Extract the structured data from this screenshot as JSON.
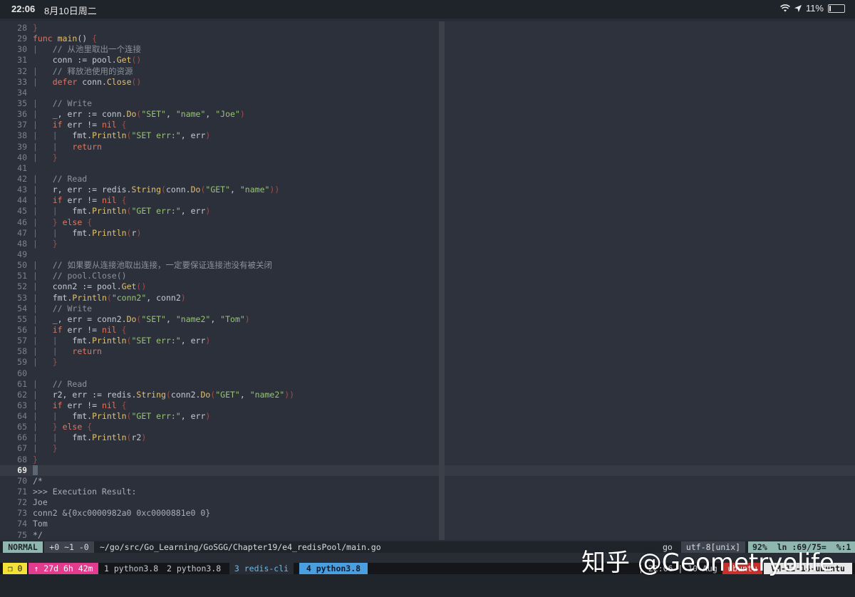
{
  "ios_status": {
    "time": "22:06",
    "date": "8月10日周二",
    "battery": "11%",
    "battery_level": 0.11
  },
  "editor": {
    "lines": [
      {
        "n": "28",
        "t": [
          [
            "}",
            "pn"
          ]
        ]
      },
      {
        "n": "29",
        "t": [
          [
            "func ",
            "kw"
          ],
          [
            "main",
            "fn"
          ],
          [
            "() ",
            "text"
          ],
          [
            "{",
            "pn"
          ]
        ]
      },
      {
        "n": "30",
        "t": [
          [
            "|   ",
            "guide"
          ],
          [
            "// 从池里取出一个连接",
            "cm"
          ]
        ]
      },
      {
        "n": "31",
        "t": [
          [
            "    conn := pool.",
            "text"
          ],
          [
            "Get",
            "fn"
          ],
          [
            "()",
            "pn"
          ]
        ]
      },
      {
        "n": "32",
        "t": [
          [
            "|   ",
            "guide"
          ],
          [
            "// 释放池使用的资源",
            "cm"
          ]
        ]
      },
      {
        "n": "33",
        "t": [
          [
            "|   ",
            "guide"
          ],
          [
            "defer ",
            "kw"
          ],
          [
            "conn.",
            "text"
          ],
          [
            "Close",
            "fn"
          ],
          [
            "()",
            "pn"
          ]
        ]
      },
      {
        "n": "34",
        "t": []
      },
      {
        "n": "35",
        "t": [
          [
            "|   ",
            "guide"
          ],
          [
            "// Write",
            "cm"
          ]
        ]
      },
      {
        "n": "36",
        "t": [
          [
            "|   ",
            "guide"
          ],
          [
            "_, err := conn.",
            "text"
          ],
          [
            "Do",
            "fn"
          ],
          [
            "(",
            "pn"
          ],
          [
            "\"SET\"",
            "str"
          ],
          [
            ", ",
            "text"
          ],
          [
            "\"name\"",
            "str"
          ],
          [
            ", ",
            "text"
          ],
          [
            "\"Joe\"",
            "str"
          ],
          [
            ")",
            "pn"
          ]
        ]
      },
      {
        "n": "37",
        "t": [
          [
            "|   ",
            "guide"
          ],
          [
            "if ",
            "kw"
          ],
          [
            "err != ",
            "text"
          ],
          [
            "nil ",
            "kw"
          ],
          [
            "{",
            "pn"
          ]
        ]
      },
      {
        "n": "38",
        "t": [
          [
            "|   |   ",
            "guide"
          ],
          [
            "fmt.",
            "text"
          ],
          [
            "Println",
            "fn"
          ],
          [
            "(",
            "pn"
          ],
          [
            "\"SET err:\"",
            "str"
          ],
          [
            ", err",
            "text"
          ],
          [
            ")",
            "pn"
          ]
        ]
      },
      {
        "n": "39",
        "t": [
          [
            "|   |   ",
            "guide"
          ],
          [
            "return",
            "kw"
          ]
        ]
      },
      {
        "n": "40",
        "t": [
          [
            "|   ",
            "guide"
          ],
          [
            "}",
            "pn"
          ]
        ]
      },
      {
        "n": "41",
        "t": []
      },
      {
        "n": "42",
        "t": [
          [
            "|   ",
            "guide"
          ],
          [
            "// Read",
            "cm"
          ]
        ]
      },
      {
        "n": "43",
        "t": [
          [
            "|   ",
            "guide"
          ],
          [
            "r, err := redis.",
            "text"
          ],
          [
            "String",
            "fn"
          ],
          [
            "(",
            "pn"
          ],
          [
            "conn.",
            "text"
          ],
          [
            "Do",
            "fn"
          ],
          [
            "(",
            "pn"
          ],
          [
            "\"GET\"",
            "str"
          ],
          [
            ", ",
            "text"
          ],
          [
            "\"name\"",
            "str"
          ],
          [
            "))",
            "pn"
          ]
        ]
      },
      {
        "n": "44",
        "t": [
          [
            "|   ",
            "guide"
          ],
          [
            "if ",
            "kw"
          ],
          [
            "err != ",
            "text"
          ],
          [
            "nil ",
            "kw"
          ],
          [
            "{",
            "pn"
          ]
        ]
      },
      {
        "n": "45",
        "t": [
          [
            "|   |   ",
            "guide"
          ],
          [
            "fmt.",
            "text"
          ],
          [
            "Println",
            "fn"
          ],
          [
            "(",
            "pn"
          ],
          [
            "\"GET err:\"",
            "str"
          ],
          [
            ", err",
            "text"
          ],
          [
            ")",
            "pn"
          ]
        ]
      },
      {
        "n": "46",
        "t": [
          [
            "|   ",
            "guide"
          ],
          [
            "} ",
            "pn"
          ],
          [
            "else ",
            "kw"
          ],
          [
            "{",
            "pn"
          ]
        ]
      },
      {
        "n": "47",
        "t": [
          [
            "|   |   ",
            "guide"
          ],
          [
            "fmt.",
            "text"
          ],
          [
            "Println",
            "fn"
          ],
          [
            "(",
            "pn"
          ],
          [
            "r",
            "text"
          ],
          [
            ")",
            "pn"
          ]
        ]
      },
      {
        "n": "48",
        "t": [
          [
            "|   ",
            "guide"
          ],
          [
            "}",
            "pn"
          ]
        ]
      },
      {
        "n": "49",
        "t": []
      },
      {
        "n": "50",
        "t": [
          [
            "|   ",
            "guide"
          ],
          [
            "// 如果要从连接池取出连接，一定要保证连接池没有被关闭",
            "cm"
          ]
        ]
      },
      {
        "n": "51",
        "t": [
          [
            "|   ",
            "guide"
          ],
          [
            "// pool.Close()",
            "cm"
          ]
        ]
      },
      {
        "n": "52",
        "t": [
          [
            "|   ",
            "guide"
          ],
          [
            "conn2 := pool.",
            "text"
          ],
          [
            "Get",
            "fn"
          ],
          [
            "()",
            "pn"
          ]
        ]
      },
      {
        "n": "53",
        "t": [
          [
            "|   ",
            "guide"
          ],
          [
            "fmt.",
            "text"
          ],
          [
            "Println",
            "fn"
          ],
          [
            "(",
            "pn"
          ],
          [
            "\"conn2\"",
            "str"
          ],
          [
            ", conn2",
            "text"
          ],
          [
            ")",
            "pn"
          ]
        ]
      },
      {
        "n": "54",
        "t": [
          [
            "|   ",
            "guide"
          ],
          [
            "// Write",
            "cm"
          ]
        ]
      },
      {
        "n": "55",
        "t": [
          [
            "|   ",
            "guide"
          ],
          [
            "_, err = conn2.",
            "text"
          ],
          [
            "Do",
            "fn"
          ],
          [
            "(",
            "pn"
          ],
          [
            "\"SET\"",
            "str"
          ],
          [
            ", ",
            "text"
          ],
          [
            "\"name2\"",
            "str"
          ],
          [
            ", ",
            "text"
          ],
          [
            "\"Tom\"",
            "str"
          ],
          [
            ")",
            "pn"
          ]
        ]
      },
      {
        "n": "56",
        "t": [
          [
            "|   ",
            "guide"
          ],
          [
            "if ",
            "kw"
          ],
          [
            "err != ",
            "text"
          ],
          [
            "nil ",
            "kw"
          ],
          [
            "{",
            "pn"
          ]
        ]
      },
      {
        "n": "57",
        "t": [
          [
            "|   |   ",
            "guide"
          ],
          [
            "fmt.",
            "text"
          ],
          [
            "Println",
            "fn"
          ],
          [
            "(",
            "pn"
          ],
          [
            "\"SET err:\"",
            "str"
          ],
          [
            ", err",
            "text"
          ],
          [
            ")",
            "pn"
          ]
        ]
      },
      {
        "n": "58",
        "t": [
          [
            "|   |   ",
            "guide"
          ],
          [
            "return",
            "kw"
          ]
        ]
      },
      {
        "n": "59",
        "t": [
          [
            "|   ",
            "guide"
          ],
          [
            "}",
            "pn"
          ]
        ]
      },
      {
        "n": "60",
        "t": []
      },
      {
        "n": "61",
        "t": [
          [
            "|   ",
            "guide"
          ],
          [
            "// Read",
            "cm"
          ]
        ]
      },
      {
        "n": "62",
        "t": [
          [
            "|   ",
            "guide"
          ],
          [
            "r2, err := redis.",
            "text"
          ],
          [
            "String",
            "fn"
          ],
          [
            "(",
            "pn"
          ],
          [
            "conn2.",
            "text"
          ],
          [
            "Do",
            "fn"
          ],
          [
            "(",
            "pn"
          ],
          [
            "\"GET\"",
            "str"
          ],
          [
            ", ",
            "text"
          ],
          [
            "\"name2\"",
            "str"
          ],
          [
            "))",
            "pn"
          ]
        ]
      },
      {
        "n": "63",
        "t": [
          [
            "|   ",
            "guide"
          ],
          [
            "if ",
            "kw"
          ],
          [
            "err != ",
            "text"
          ],
          [
            "nil ",
            "kw"
          ],
          [
            "{",
            "pn"
          ]
        ]
      },
      {
        "n": "64",
        "t": [
          [
            "|   |   ",
            "guide"
          ],
          [
            "fmt.",
            "text"
          ],
          [
            "Println",
            "fn"
          ],
          [
            "(",
            "pn"
          ],
          [
            "\"GET err:\"",
            "str"
          ],
          [
            ", err",
            "text"
          ],
          [
            ")",
            "pn"
          ]
        ]
      },
      {
        "n": "65",
        "t": [
          [
            "|   ",
            "guide"
          ],
          [
            "} ",
            "pn"
          ],
          [
            "else ",
            "kw"
          ],
          [
            "{",
            "pn"
          ]
        ]
      },
      {
        "n": "66",
        "t": [
          [
            "|   |   ",
            "guide"
          ],
          [
            "fmt.",
            "text"
          ],
          [
            "Println",
            "fn"
          ],
          [
            "(",
            "pn"
          ],
          [
            "r2",
            "text"
          ],
          [
            ")",
            "pn"
          ]
        ]
      },
      {
        "n": "67",
        "t": [
          [
            "|   ",
            "guide"
          ],
          [
            "}",
            "pn"
          ]
        ]
      },
      {
        "n": "68",
        "t": [
          [
            "}",
            "pn"
          ]
        ]
      },
      {
        "n": "69",
        "t": [],
        "current": true
      },
      {
        "n": "70",
        "t": [
          [
            "/*",
            "out"
          ]
        ]
      },
      {
        "n": "71",
        "t": [
          [
            ">>> Execution Result:",
            "out"
          ]
        ]
      },
      {
        "n": "72",
        "t": [
          [
            "Joe",
            "out"
          ]
        ]
      },
      {
        "n": "73",
        "t": [
          [
            "conn2 &{0xc0000982a0 0xc0000881e0 0}",
            "out"
          ]
        ]
      },
      {
        "n": "74",
        "t": [
          [
            "Tom",
            "out"
          ]
        ]
      },
      {
        "n": "75",
        "t": [
          [
            "*/",
            "out"
          ]
        ]
      }
    ]
  },
  "vim_status": {
    "mode": "NORMAL",
    "git": "+0 ~1 -0",
    "filepath": "~/go/src/Go_Learning/GoSGG/Chapter19/e4_redisPool/main.go",
    "filetype": "go",
    "encoding": "utf-8[unix]",
    "position": "92%  ln :69/75=  %:1"
  },
  "tmux": {
    "session": "❐ 0",
    "uptime": "↑ 27d 6h 42m",
    "win1": "1 python3.8",
    "win2": "2 python3.8",
    "win3": "3 redis-cli",
    "win4": "4 python3.8",
    "datetime": "| 22:06 | 10 Aug",
    "host": "ubuntu",
    "vm": "VM-12-14-ubuntu"
  },
  "watermark": "知乎 @Geometryolife"
}
